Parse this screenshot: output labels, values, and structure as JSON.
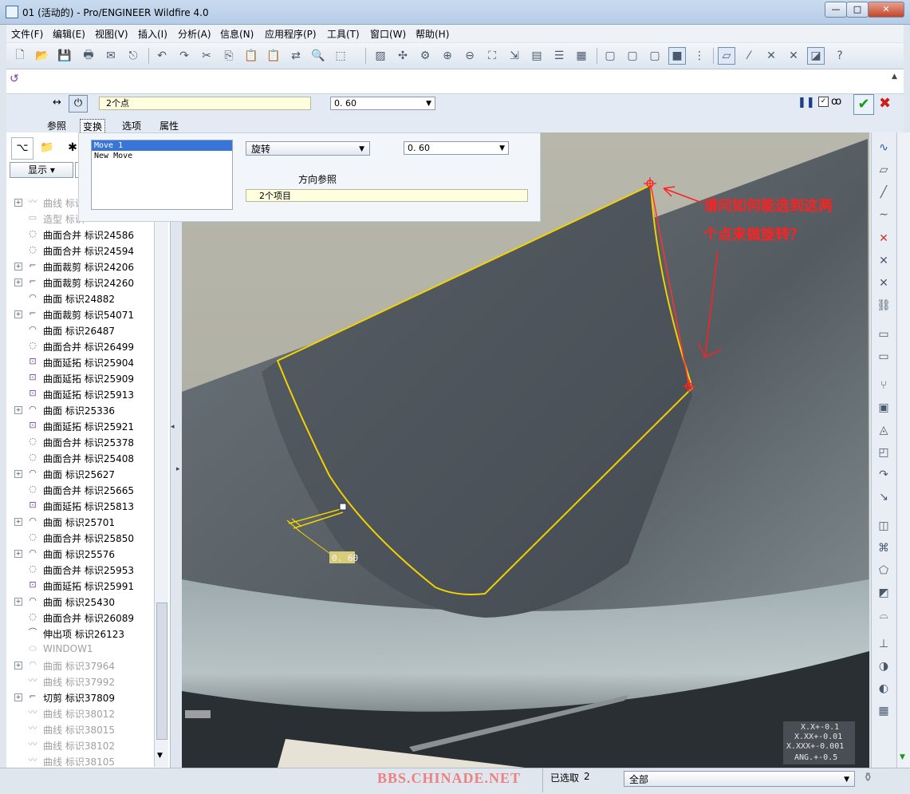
{
  "window": {
    "title": "01 (活动的) - Pro/ENGINEER Wildfire 4.0",
    "min_label": "—",
    "max_label": "□",
    "close_label": "✕"
  },
  "menu": [
    "文件(F)",
    "编辑(E)",
    "视图(V)",
    "插入(I)",
    "分析(A)",
    "信息(N)",
    "应用程序(P)",
    "工具(T)",
    "窗口(W)",
    "帮助(H)"
  ],
  "dashboard": {
    "reference_value": "2个点",
    "offset_value": "0. 60",
    "tabs": [
      "参照",
      "变换",
      "选项",
      "属性"
    ],
    "active_tab": "变换"
  },
  "panel": {
    "moves": [
      "Move 1",
      "New Move"
    ],
    "type_value": "旋转",
    "angle_value": "0. 60",
    "direction_ref_label": "方向参照",
    "direction_ref_value": "2个项目"
  },
  "tree": {
    "show_button": "显示",
    "items": [
      {
        "label": "曲线 标识",
        "icon": "curve-icon",
        "dim": true,
        "expand": true
      },
      {
        "label": "造型 标识",
        "icon": "style-icon",
        "dim": true,
        "expand": false
      },
      {
        "label": "曲面合并 标识24586",
        "icon": "merge-icon",
        "dim": false,
        "expand": false
      },
      {
        "label": "曲面合并 标识24594",
        "icon": "merge-icon",
        "dim": false,
        "expand": false
      },
      {
        "label": "曲面裁剪 标识24206",
        "icon": "trim-icon",
        "dim": false,
        "expand": true
      },
      {
        "label": "曲面裁剪 标识24260",
        "icon": "trim-icon",
        "dim": false,
        "expand": true
      },
      {
        "label": "曲面 标识24882",
        "icon": "surface-icon",
        "dim": false,
        "expand": false
      },
      {
        "label": "曲面裁剪 标识54071",
        "icon": "trim-icon",
        "dim": false,
        "expand": true
      },
      {
        "label": "曲面 标识26487",
        "icon": "surface-icon",
        "dim": false,
        "expand": false
      },
      {
        "label": "曲面合并 标识26499",
        "icon": "merge-icon",
        "dim": false,
        "expand": false
      },
      {
        "label": "曲面延拓 标识25904",
        "icon": "extend-icon",
        "dim": false,
        "expand": false
      },
      {
        "label": "曲面延拓 标识25909",
        "icon": "extend-icon",
        "dim": false,
        "expand": false
      },
      {
        "label": "曲面延拓 标识25913",
        "icon": "extend-icon",
        "dim": false,
        "expand": false
      },
      {
        "label": "曲面 标识25336",
        "icon": "surface-icon",
        "dim": false,
        "expand": true
      },
      {
        "label": "曲面延拓 标识25921",
        "icon": "extend-icon",
        "dim": false,
        "expand": false
      },
      {
        "label": "曲面合并 标识25378",
        "icon": "merge-icon",
        "dim": false,
        "expand": false
      },
      {
        "label": "曲面合并 标识25408",
        "icon": "merge-icon",
        "dim": false,
        "expand": false
      },
      {
        "label": "曲面 标识25627",
        "icon": "surface-icon",
        "dim": false,
        "expand": true
      },
      {
        "label": "曲面合并 标识25665",
        "icon": "merge-icon",
        "dim": false,
        "expand": false
      },
      {
        "label": "曲面延拓 标识25813",
        "icon": "extend-icon",
        "dim": false,
        "expand": false
      },
      {
        "label": "曲面 标识25701",
        "icon": "surface-icon",
        "dim": false,
        "expand": true
      },
      {
        "label": "曲面合并 标识25850",
        "icon": "merge-icon",
        "dim": false,
        "expand": false
      },
      {
        "label": "曲面 标识25576",
        "icon": "surface-icon",
        "dim": false,
        "expand": true
      },
      {
        "label": "曲面合并 标识25953",
        "icon": "merge-icon",
        "dim": false,
        "expand": false
      },
      {
        "label": "曲面延拓 标识25991",
        "icon": "extend-icon",
        "dim": false,
        "expand": false
      },
      {
        "label": "曲面 标识25430",
        "icon": "surface-icon",
        "dim": false,
        "expand": true
      },
      {
        "label": "曲面合并 标识26089",
        "icon": "merge-icon",
        "dim": false,
        "expand": false
      },
      {
        "label": "伸出项 标识26123",
        "icon": "protrusion-icon",
        "dim": false,
        "expand": false
      },
      {
        "label": "WINDOW1",
        "icon": "window-icon",
        "dim": true,
        "expand": false
      },
      {
        "label": "曲面 标识37964",
        "icon": "surface-icon",
        "dim": true,
        "expand": true
      },
      {
        "label": "曲线 标识37992",
        "icon": "curve-icon",
        "dim": true,
        "expand": false
      },
      {
        "label": "切剪 标识37809",
        "icon": "cut-icon",
        "dim": false,
        "expand": true
      },
      {
        "label": "曲线 标识38012",
        "icon": "curve-icon",
        "dim": true,
        "expand": false
      },
      {
        "label": "曲线 标识38015",
        "icon": "curve-icon",
        "dim": true,
        "expand": false
      },
      {
        "label": "曲线 标识38102",
        "icon": "curve-icon",
        "dim": true,
        "expand": false
      },
      {
        "label": "曲线 标识38105",
        "icon": "curve-icon",
        "dim": true,
        "expand": false
      }
    ]
  },
  "graphics": {
    "annotation_line1": "请问如何能选到这两",
    "annotation_line2": "个点来做旋转？",
    "dim_value": "0. 60",
    "tolerance": [
      "X.X+-0.1",
      "X.XX+-0.01",
      "X.XXX+-0.001",
      "ANG.+-0.5"
    ],
    "accent": "#ff2020",
    "highlight": "#ffee00"
  },
  "status": {
    "watermark": "BBS.CHINADE.NET",
    "selected_label": "已选取",
    "selected_count": "2",
    "filter_value": "全部"
  }
}
